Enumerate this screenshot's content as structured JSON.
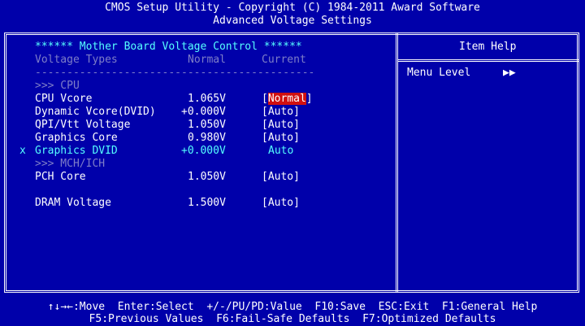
{
  "header": {
    "title": "CMOS Setup Utility - Copyright (C) 1984-2011 Award Software",
    "subtitle": "Advanced Voltage Settings"
  },
  "main": {
    "section_title": "****** Mother Board Voltage Control ******",
    "columns": {
      "type": "Voltage Types",
      "normal": "Normal",
      "current": "Current"
    },
    "separator": "--------------------------------------------",
    "groups": {
      "cpu": ">>> CPU",
      "mch": ">>> MCH/ICH"
    },
    "rows": [
      {
        "marker": "",
        "label": "CPU Vcore",
        "normal": "1.065V",
        "current": "Normal",
        "selected": true
      },
      {
        "marker": "",
        "label": "Dynamic Vcore(DVID)",
        "normal": "+0.000V",
        "current": "Auto"
      },
      {
        "marker": "",
        "label": "QPI/Vtt Voltage",
        "normal": "1.050V",
        "current": "Auto"
      },
      {
        "marker": "",
        "label": "Graphics Core",
        "normal": "0.980V",
        "current": "Auto"
      },
      {
        "marker": "x",
        "label": "Graphics DVID",
        "normal": "+0.000V",
        "current": "Auto",
        "disabled": true
      },
      {
        "marker": "",
        "label": "PCH Core",
        "normal": "1.050V",
        "current": "Auto"
      },
      {
        "marker": "",
        "label": "DRAM Voltage",
        "normal": "1.500V",
        "current": "Auto"
      }
    ]
  },
  "help": {
    "title": "Item Help",
    "menu_level_label": "Menu Level",
    "menu_level_value": "▶▶"
  },
  "footer": {
    "line1": "↑↓→←:Move  Enter:Select  +/-/PU/PD:Value  F10:Save  ESC:Exit  F1:General Help",
    "line2": "F5:Previous Values  F6:Fail-Safe Defaults  F7:Optimized Defaults"
  },
  "colors": {
    "background": "#0000AA",
    "text": "#FFFFFF",
    "accent": "#55FFFF",
    "disabled": "#7E7EC8",
    "selection": "#D01010"
  }
}
